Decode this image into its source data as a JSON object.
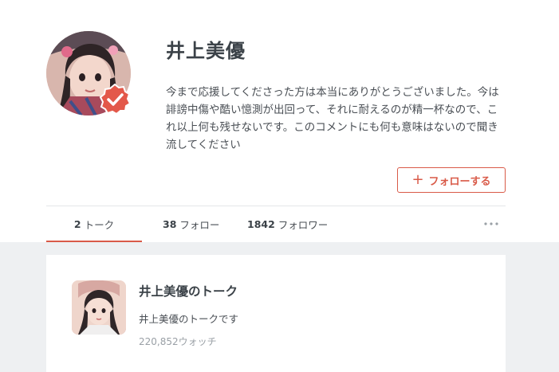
{
  "profile": {
    "name": "井上美優",
    "bio": "今まで応援してくださった方は本当にありがとうございました。今は誹謗中傷や酷い憶測が出回って、それに耐えるのが精一杯なので、これ以上何も残せないです。このコメントにも何も意味はないので聞き流してください",
    "follow_button": "フォローする",
    "follow_icon": "plus-icon",
    "verified_icon": "check-badge-icon"
  },
  "stats": {
    "talks": {
      "count": "2",
      "label": "トーク"
    },
    "follow": {
      "count": "38",
      "label": "フォロー"
    },
    "followers": {
      "count": "1842",
      "label": "フォロワー"
    },
    "more_icon": "more-horizontal-icon"
  },
  "talk": {
    "title": "井上美優のトーク",
    "description": "井上美優のトークです",
    "watch_count": "220,852ウォッチ"
  },
  "colors": {
    "accent": "#d95a48",
    "background_feed": "#eef0f2",
    "text_primary": "#3b4248"
  }
}
